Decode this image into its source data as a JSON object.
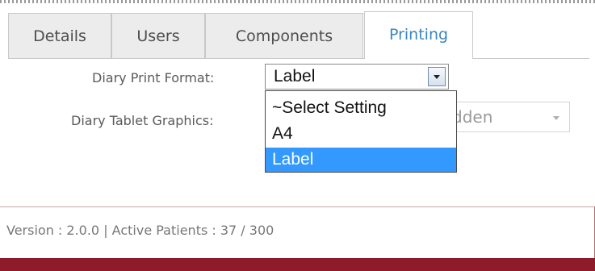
{
  "tabs": [
    {
      "label": "Details",
      "active": false
    },
    {
      "label": "Users",
      "active": false
    },
    {
      "label": "Components",
      "active": false
    },
    {
      "label": "Printing",
      "active": true
    }
  ],
  "form": {
    "diary_print_format": {
      "label": "Diary Print Format:",
      "value": "Label",
      "options": [
        "~Select Setting",
        "A4",
        "Label"
      ],
      "highlighted": "Label"
    },
    "diary_tablet_graphics": {
      "label": "Diary Tablet Graphics:",
      "value_partial": "dden"
    }
  },
  "footer": {
    "text": "Version : 2.0.0 | Active Patients : 37 / 300"
  },
  "colors": {
    "active_tab_text": "#3a87c0",
    "highlight": "#3399ff",
    "footer_bar": "#8e1b2a"
  }
}
